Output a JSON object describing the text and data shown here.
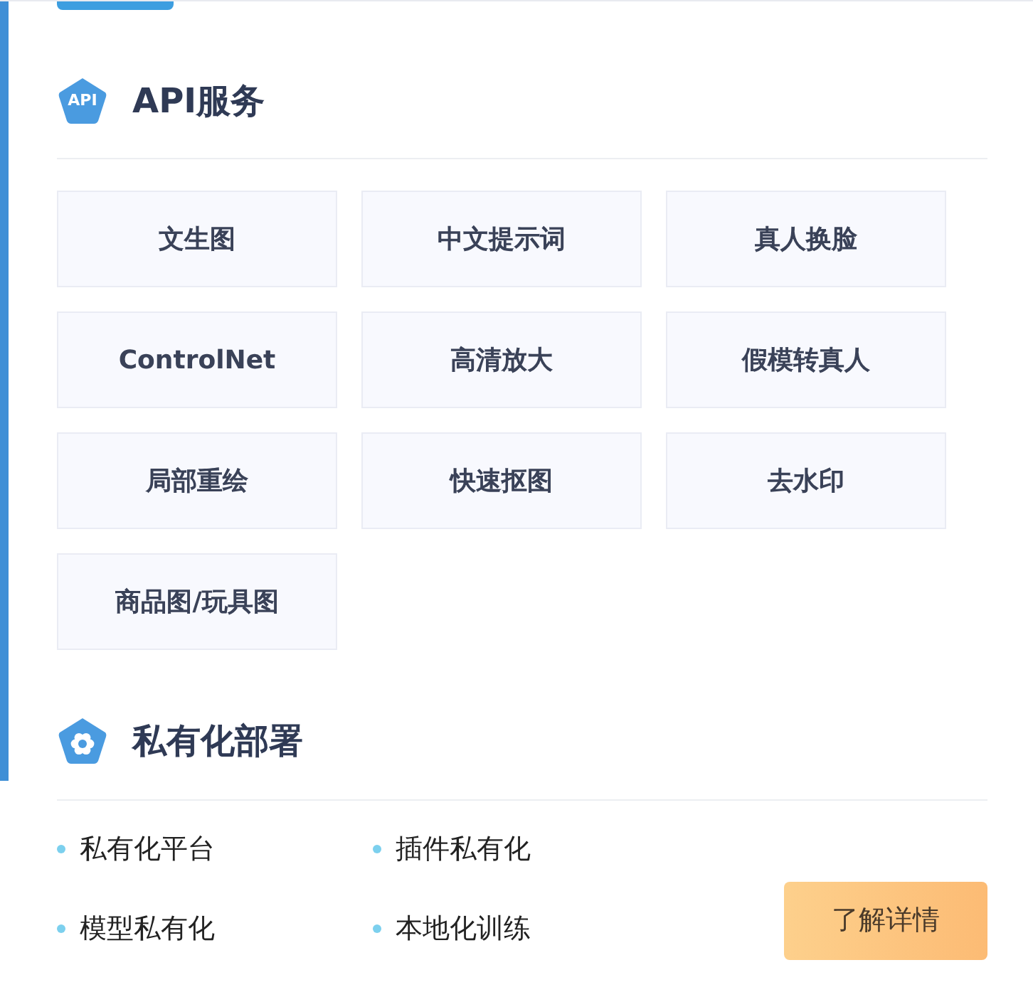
{
  "api_section": {
    "icon_label": "API",
    "title": "API服务",
    "services": [
      {
        "label": "文生图"
      },
      {
        "label": "中文提示词"
      },
      {
        "label": "真人换脸"
      },
      {
        "label": "ControlNet"
      },
      {
        "label": "高清放大"
      },
      {
        "label": "假模转真人"
      },
      {
        "label": "局部重绘"
      },
      {
        "label": "快速抠图"
      },
      {
        "label": "去水印"
      },
      {
        "label": "商品图/玩具图"
      }
    ]
  },
  "private_section": {
    "title": "私有化部署",
    "items": [
      {
        "label": "私有化平台"
      },
      {
        "label": "插件私有化"
      },
      {
        "label": "模型私有化"
      },
      {
        "label": "本地化训练"
      }
    ],
    "button": "了解详情"
  }
}
